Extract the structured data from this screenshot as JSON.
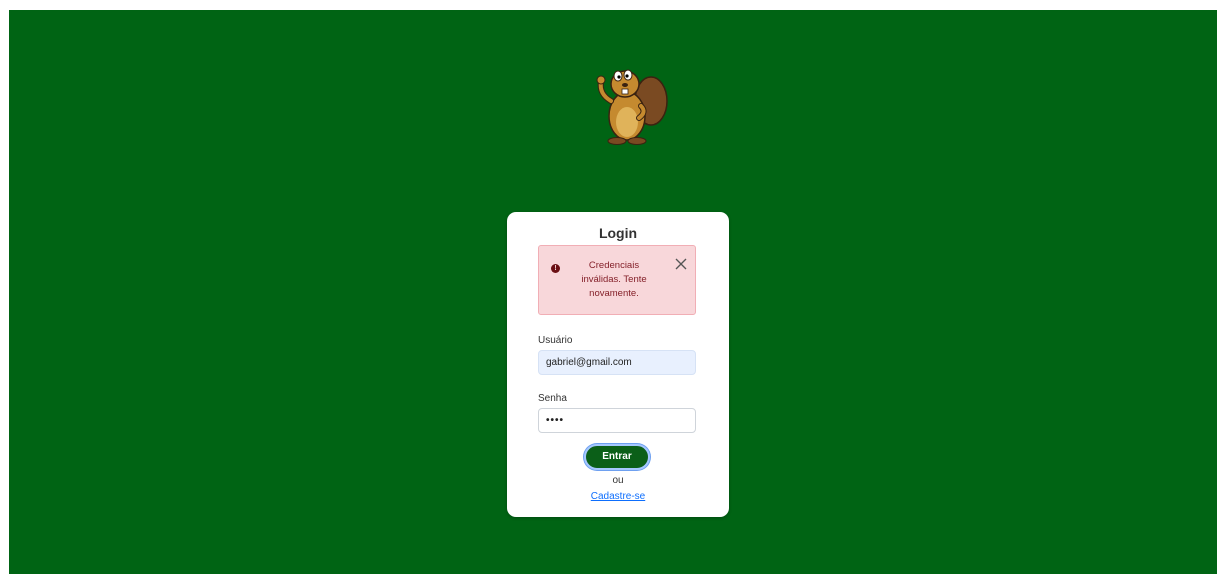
{
  "colors": {
    "background": "#006414",
    "card": "#ffffff",
    "alert_bg": "#f8d7da",
    "alert_text": "#842029",
    "button": "#0b5f18",
    "link": "#0d6efd"
  },
  "header": {
    "mascot_icon": "beaver-mascot-icon"
  },
  "login": {
    "title": "Login",
    "alert": {
      "icon": "exclamation-circle-icon",
      "message": "Credenciais inválidas. Tente novamente.",
      "close_icon": "close-icon"
    },
    "username": {
      "label": "Usuário",
      "value": "gabriel@gmail.com"
    },
    "password": {
      "label": "Senha",
      "value": "••••"
    },
    "submit_label": "Entrar",
    "or_text": "ou",
    "signup_link": "Cadastre-se"
  }
}
